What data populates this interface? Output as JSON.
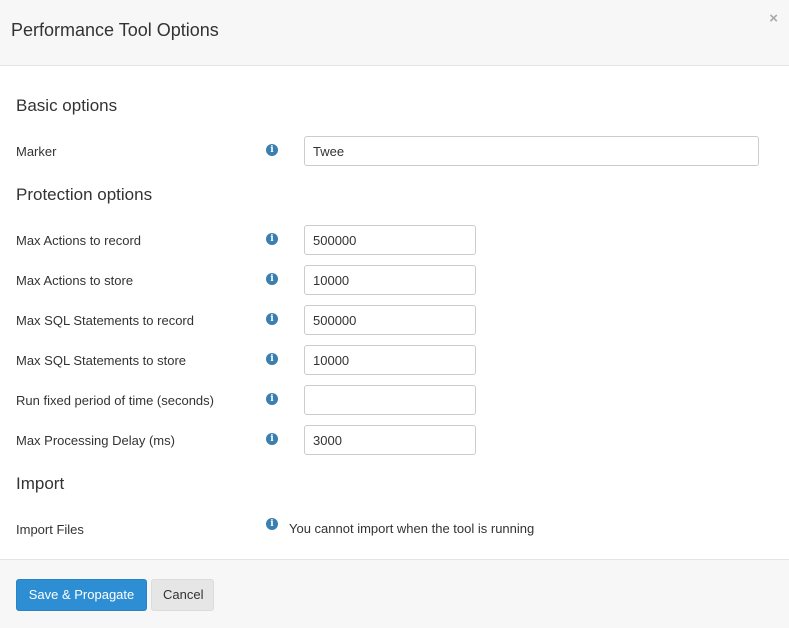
{
  "modal": {
    "title": "Performance Tool Options",
    "close_label": "×"
  },
  "basic": {
    "heading": "Basic options",
    "marker": {
      "label": "Marker",
      "value": "Twee"
    }
  },
  "protection": {
    "heading": "Protection options",
    "fields": [
      {
        "label": "Max Actions to record",
        "value": "500000"
      },
      {
        "label": "Max Actions to store",
        "value": "10000"
      },
      {
        "label": "Max SQL Statements to record",
        "value": "500000"
      },
      {
        "label": "Max SQL Statements to store",
        "value": "10000"
      },
      {
        "label": "Run fixed period of time (seconds)",
        "value": ""
      },
      {
        "label": "Max Processing Delay (ms)",
        "value": "3000"
      }
    ]
  },
  "import": {
    "heading": "Import",
    "label": "Import Files",
    "note": "You cannot import when the tool is running"
  },
  "footer": {
    "save_label": "Save & Propagate",
    "cancel_label": "Cancel"
  },
  "icons": {
    "info": "info-icon",
    "close": "close-icon"
  },
  "colors": {
    "primary": "#2d8ed4",
    "info": "#3a7fb0",
    "header_bg": "#f7f7f7"
  }
}
